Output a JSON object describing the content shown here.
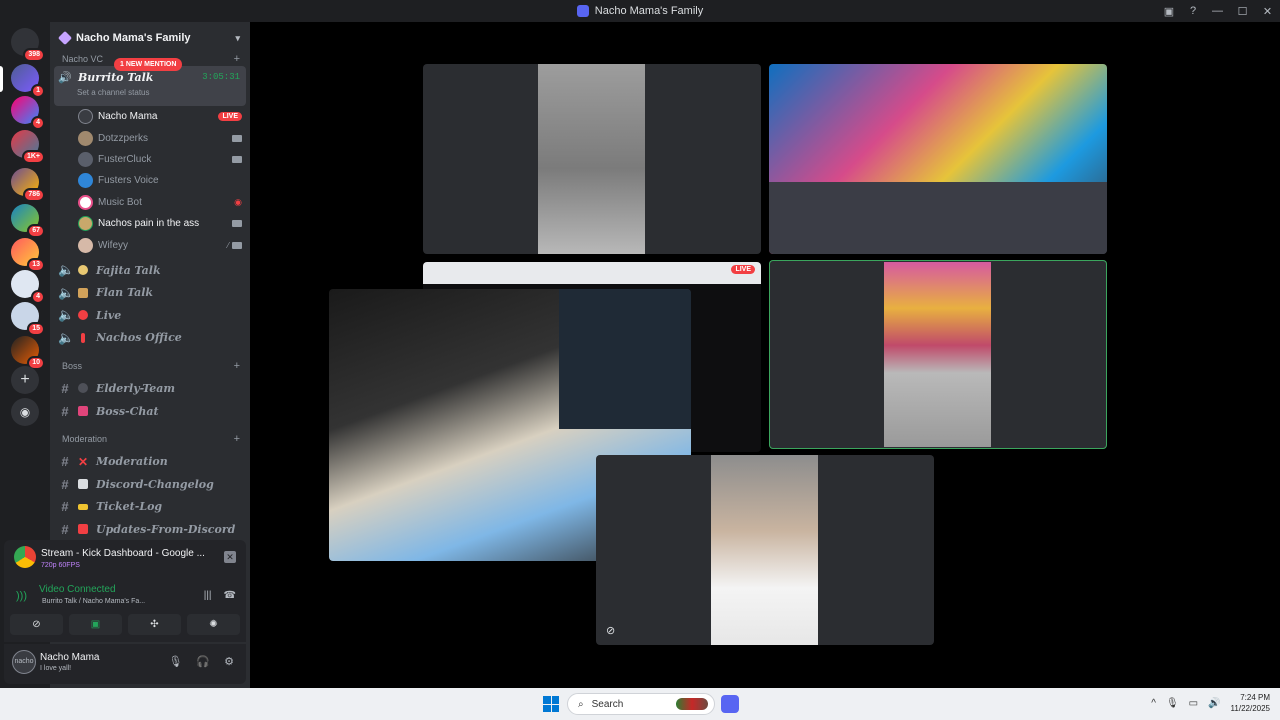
{
  "window": {
    "title": "Nacho Mama's Family"
  },
  "guilds": {
    "badges": [
      "398",
      "1",
      "4",
      "1K+",
      "786",
      "67",
      "13",
      "4",
      "15",
      "10"
    ]
  },
  "server": {
    "name": "Nacho Mama's Family"
  },
  "voice_category": "Nacho VC",
  "active_channel": {
    "name": "Burrito Talk",
    "timer": "3:05:31",
    "mention": "1 NEW MENTION",
    "status_placeholder": "Set a channel status"
  },
  "members": [
    {
      "name": "Nacho Mama",
      "badge": "LIVE"
    },
    {
      "name": "Dotzzperks"
    },
    {
      "name": "FusterCluck"
    },
    {
      "name": "Fusters Voice"
    },
    {
      "name": "Music Bot"
    },
    {
      "name": "Nachos pain in the ass"
    },
    {
      "name": "Wifeyy"
    }
  ],
  "voice_channels": [
    "Fajita Talk",
    "Flan Talk",
    "Live",
    "Nachos Office"
  ],
  "boss_category": "Boss",
  "boss_channels": [
    "Elderly-Team",
    "Boss-Chat"
  ],
  "mod_category": "Moderation",
  "mod_channels": [
    "Moderation",
    "Discord-Changelog",
    "Ticket-Log",
    "Updates-From-Discord"
  ],
  "stream_panel": {
    "title": "Stream - Kick Dashboard - Google ...",
    "quality": "720p 60FPS"
  },
  "rtc_panel": {
    "status": "Video Connected",
    "channel": "Burrito Talk / Nacho Mama's Fa..."
  },
  "user_panel": {
    "name": "Nacho Mama",
    "avatar_text": "nacho",
    "status": "I love yall!"
  },
  "stage": {
    "live_badge": "LIVE"
  },
  "taskbar": {
    "search_placeholder": "Search",
    "time": "7:24 PM",
    "date": "11/22/2025"
  },
  "colors": {
    "accent": "#5865f2",
    "live": "#f23f43",
    "connected": "#23a55a",
    "speaking": "#3ba55d"
  }
}
